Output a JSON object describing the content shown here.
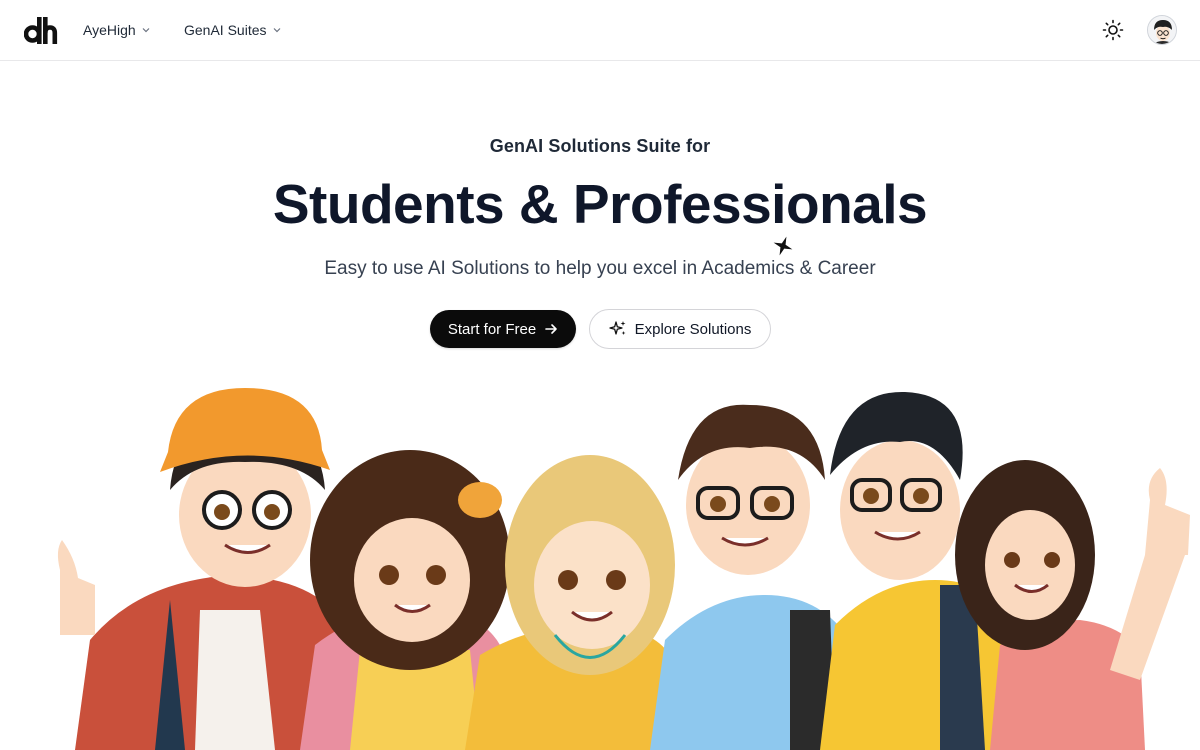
{
  "header": {
    "logo_icon": "dh-logo-icon",
    "nav": [
      {
        "label": "AyeHigh",
        "icon": "chevron-down-icon"
      },
      {
        "label": "GenAI Suites",
        "icon": "chevron-down-icon"
      }
    ],
    "theme_icon": "sun-icon",
    "avatar_icon": "user-avatar"
  },
  "hero": {
    "eyebrow": "GenAI Solutions Suite for",
    "headline": "Students & Professionals",
    "subhead": "Easy to use AI Solutions to help you excel in Academics & Career",
    "primary_cta": {
      "label": "Start for Free",
      "icon": "arrow-right-icon"
    },
    "secondary_cta": {
      "label": "Explore Solutions",
      "icon": "sparkles-icon"
    }
  },
  "illustration": {
    "icon": "students-group-illustration"
  },
  "colors": {
    "primary_button": "#0b0b0b",
    "text_dark": "#0f172a",
    "border": "#d4d4d8"
  }
}
